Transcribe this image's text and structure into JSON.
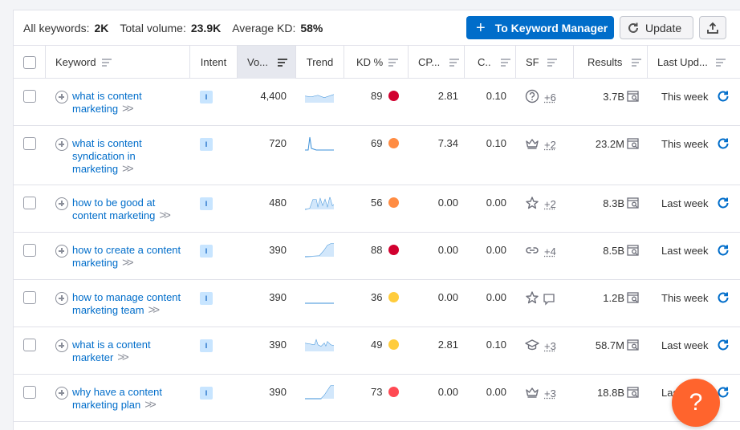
{
  "summary": {
    "all_keywords_label": "All keywords:",
    "all_keywords_value": "2K",
    "total_volume_label": "Total volume:",
    "total_volume_value": "23.9K",
    "avg_kd_label": "Average KD:",
    "avg_kd_value": "58%"
  },
  "toolbar": {
    "keyword_manager_label": "To Keyword Manager",
    "update_label": "Update"
  },
  "columns": {
    "keyword": "Keyword",
    "intent": "Intent",
    "volume": "Vo...",
    "trend": "Trend",
    "kd": "KD %",
    "cpc": "CP...",
    "com": "C..",
    "sf": "SF",
    "results": "Results",
    "last_updated": "Last Upd..."
  },
  "colors": {
    "accent": "#006dca",
    "kd_red": "#d1002f",
    "kd_orange": "#ff8c43",
    "kd_yellow": "#ffcc3c",
    "kd_light_red": "#ff4953",
    "help": "#ff642d"
  },
  "rows": [
    {
      "keyword_lines": [
        "what is content",
        "marketing"
      ],
      "intent": "I",
      "volume": "4,400",
      "trend": "flat-high",
      "kd": "89",
      "kd_color": "#d1002f",
      "cpc": "2.81",
      "com": "0.10",
      "sf_icon": "question-icon",
      "sf_more": "+6",
      "results": "3.7B",
      "updated": "This week"
    },
    {
      "keyword_lines": [
        "what is content",
        "syndication in",
        "marketing"
      ],
      "intent": "I",
      "volume": "720",
      "trend": "spike",
      "kd": "69",
      "kd_color": "#ff8c43",
      "cpc": "7.34",
      "com": "0.10",
      "sf_icon": "crown-icon",
      "sf_more": "+2",
      "results": "23.2M",
      "updated": "This week"
    },
    {
      "keyword_lines": [
        "how to be good at",
        "content marketing"
      ],
      "intent": "I",
      "volume": "480",
      "trend": "multi-spike",
      "kd": "56",
      "kd_color": "#ff8c43",
      "cpc": "0.00",
      "com": "0.00",
      "sf_icon": "star-icon",
      "sf_more": "+2",
      "results": "8.3B",
      "updated": "Last week"
    },
    {
      "keyword_lines": [
        "how to create a content",
        "marketing"
      ],
      "intent": "I",
      "volume": "390",
      "trend": "rise",
      "kd": "88",
      "kd_color": "#d1002f",
      "cpc": "0.00",
      "com": "0.00",
      "sf_icon": "link-icon",
      "sf_more": "+4",
      "results": "8.5B",
      "updated": "Last week"
    },
    {
      "keyword_lines": [
        "how to manage content",
        "marketing team"
      ],
      "intent": "I",
      "volume": "390",
      "trend": "flat-low",
      "kd": "36",
      "kd_color": "#ffcc3c",
      "cpc": "0.00",
      "com": "0.00",
      "sf_icon": "star-icon",
      "sf_more": "",
      "results": "1.2B",
      "updated": "This week"
    },
    {
      "keyword_lines": [
        "what is a content",
        "marketer"
      ],
      "intent": "I",
      "volume": "390",
      "trend": "wavy",
      "kd": "49",
      "kd_color": "#ffcc3c",
      "cpc": "2.81",
      "com": "0.10",
      "sf_icon": "grad-cap-icon",
      "sf_more": "+3",
      "results": "58.7M",
      "updated": "Last week"
    },
    {
      "keyword_lines": [
        "why have a content",
        "marketing plan"
      ],
      "intent": "I",
      "volume": "390",
      "trend": "rise-late",
      "kd": "73",
      "kd_color": "#ff4953",
      "cpc": "0.00",
      "com": "0.00",
      "sf_icon": "crown-icon",
      "sf_more": "+3",
      "results": "18.8B",
      "updated": "Last week"
    }
  ],
  "help_label": "?"
}
